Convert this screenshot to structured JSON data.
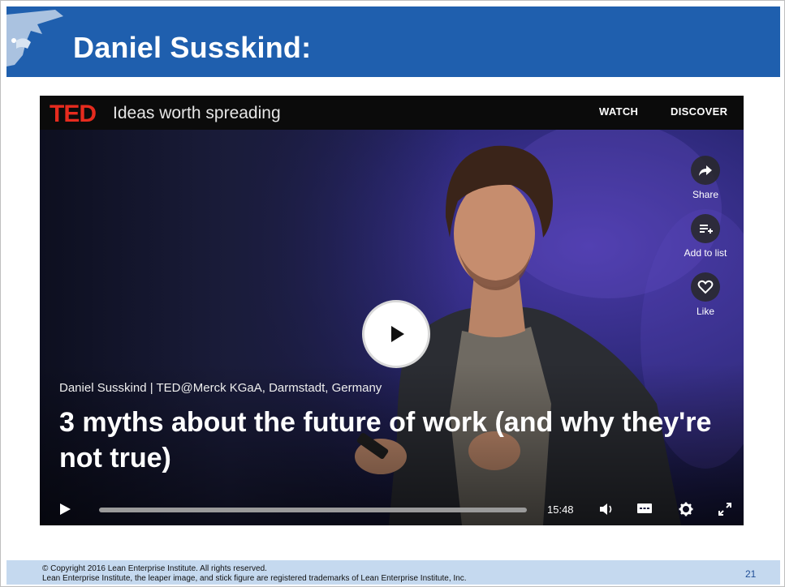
{
  "slide": {
    "title": "Daniel Susskind:",
    "page_number": "21",
    "copyright_line1": "© Copyright 2016 Lean Enterprise Institute. All rights reserved.",
    "copyright_line2": "Lean Enterprise Institute, the leaper image, and stick figure are registered trademarks of Lean Enterprise Institute, Inc."
  },
  "ted": {
    "logo": "TED",
    "tagline": "Ideas worth spreading",
    "nav": {
      "watch": "WATCH",
      "discover": "DISCOVER"
    }
  },
  "video": {
    "speaker_line": "Daniel Susskind | TED@Merck KGaA, Darmstadt, Germany",
    "title": "3 myths about the future of work (and why they're not true)",
    "duration": "15:48",
    "progress": 0
  },
  "actions": {
    "share": "Share",
    "add_to_list": "Add to list",
    "like": "Like"
  },
  "colors": {
    "header_blue": "#1f5fae",
    "footer_blue": "#c5d9ef",
    "ted_red": "#e62b1e"
  },
  "icons": [
    "leaper-logo-icon",
    "share-icon",
    "add-to-list-icon",
    "heart-icon",
    "play-icon",
    "volume-icon",
    "captions-icon",
    "gear-icon",
    "fullscreen-icon"
  ]
}
